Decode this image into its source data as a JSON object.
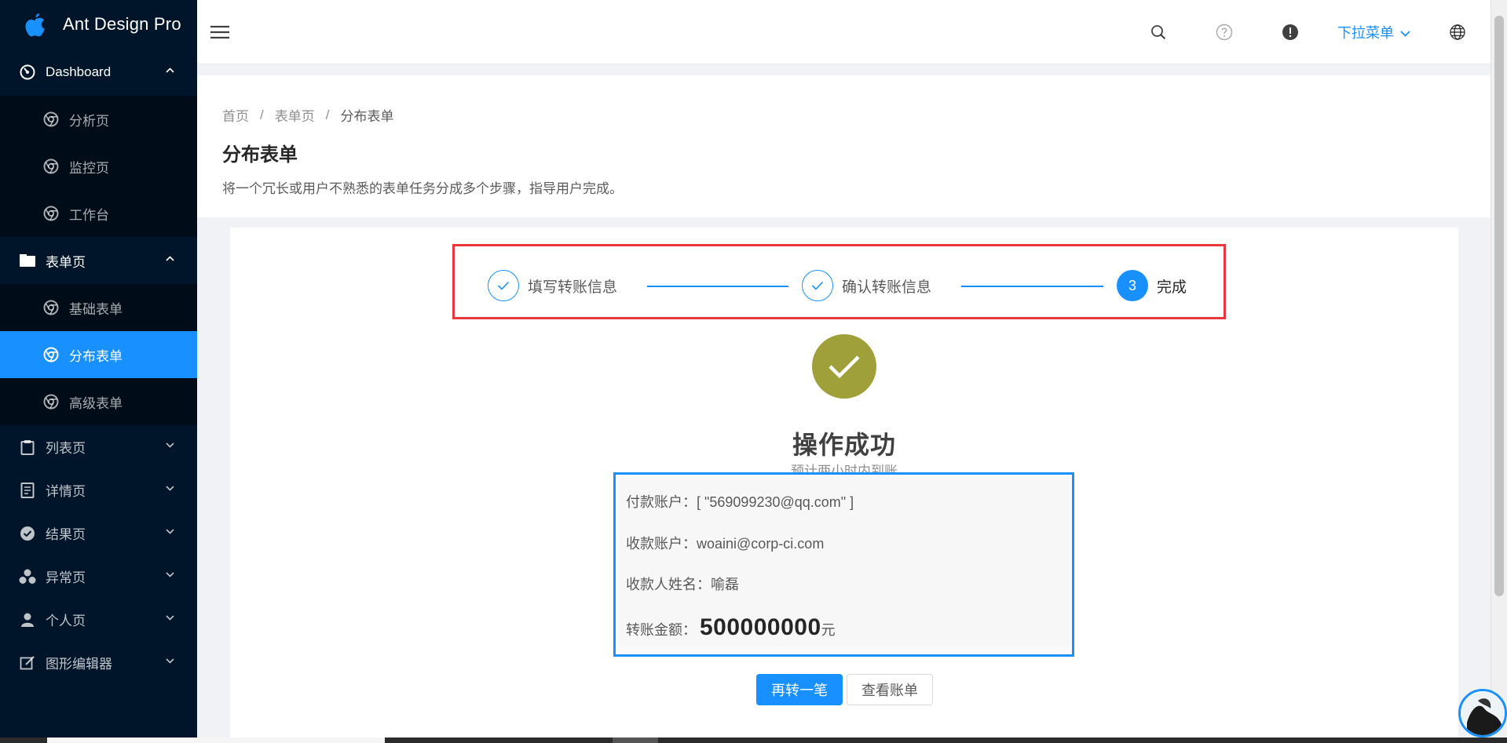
{
  "app": {
    "title": "Ant Design Pro"
  },
  "header": {
    "dropdown_label": "下拉菜单"
  },
  "sidebar": {
    "items": [
      {
        "label": "Dashboard",
        "icon": "dashboard-icon",
        "expanded": true
      },
      {
        "label": "分析页",
        "icon": "chrome-icon",
        "sub": true
      },
      {
        "label": "监控页",
        "icon": "chrome-icon",
        "sub": true
      },
      {
        "label": "工作台",
        "icon": "chrome-icon",
        "sub": true
      },
      {
        "label": "表单页",
        "icon": "form-icon",
        "expanded": true
      },
      {
        "label": "基础表单",
        "icon": "chrome-icon",
        "sub": true
      },
      {
        "label": "分布表单",
        "icon": "chrome-icon",
        "sub": true,
        "selected": true
      },
      {
        "label": "高级表单",
        "icon": "chrome-icon",
        "sub": true
      },
      {
        "label": "列表页",
        "icon": "clipboard-icon",
        "expanded": false
      },
      {
        "label": "详情页",
        "icon": "profile-icon",
        "expanded": false
      },
      {
        "label": "结果页",
        "icon": "check-circle-icon",
        "expanded": false
      },
      {
        "label": "异常页",
        "icon": "warning-icon",
        "expanded": false
      },
      {
        "label": "个人页",
        "icon": "user-icon",
        "expanded": false
      },
      {
        "label": "图形编辑器",
        "icon": "edit-icon",
        "expanded": false
      }
    ]
  },
  "breadcrumb": [
    "首页",
    "表单页",
    "分布表单"
  ],
  "page": {
    "title": "分布表单",
    "description": "将一个冗长或用户不熟悉的表单任务分成多个步骤，指导用户完成。"
  },
  "steps": [
    {
      "title": "填写转账信息",
      "status": "finish"
    },
    {
      "title": "确认转账信息",
      "status": "finish"
    },
    {
      "title": "完成",
      "status": "process",
      "number": "3"
    }
  ],
  "result": {
    "title": "操作成功",
    "subtitle": "预计两小时内到账",
    "rows": [
      {
        "key": "付款账户：",
        "value": "[ \"569099230@qq.com\" ]"
      },
      {
        "key": "收款账户：",
        "value": "woaini@corp-ci.com"
      },
      {
        "key": "收款人姓名：",
        "value": "喻磊"
      },
      {
        "key": "转账金额：",
        "value": "500000000",
        "unit": "元"
      }
    ],
    "buttons": {
      "primary": "再转一笔",
      "secondary": "查看账单"
    }
  },
  "colors": {
    "sider_bg": "#001529",
    "primary": "#1890ff",
    "success_icon": "#a0a03a",
    "highlight_red": "#e8383d"
  }
}
